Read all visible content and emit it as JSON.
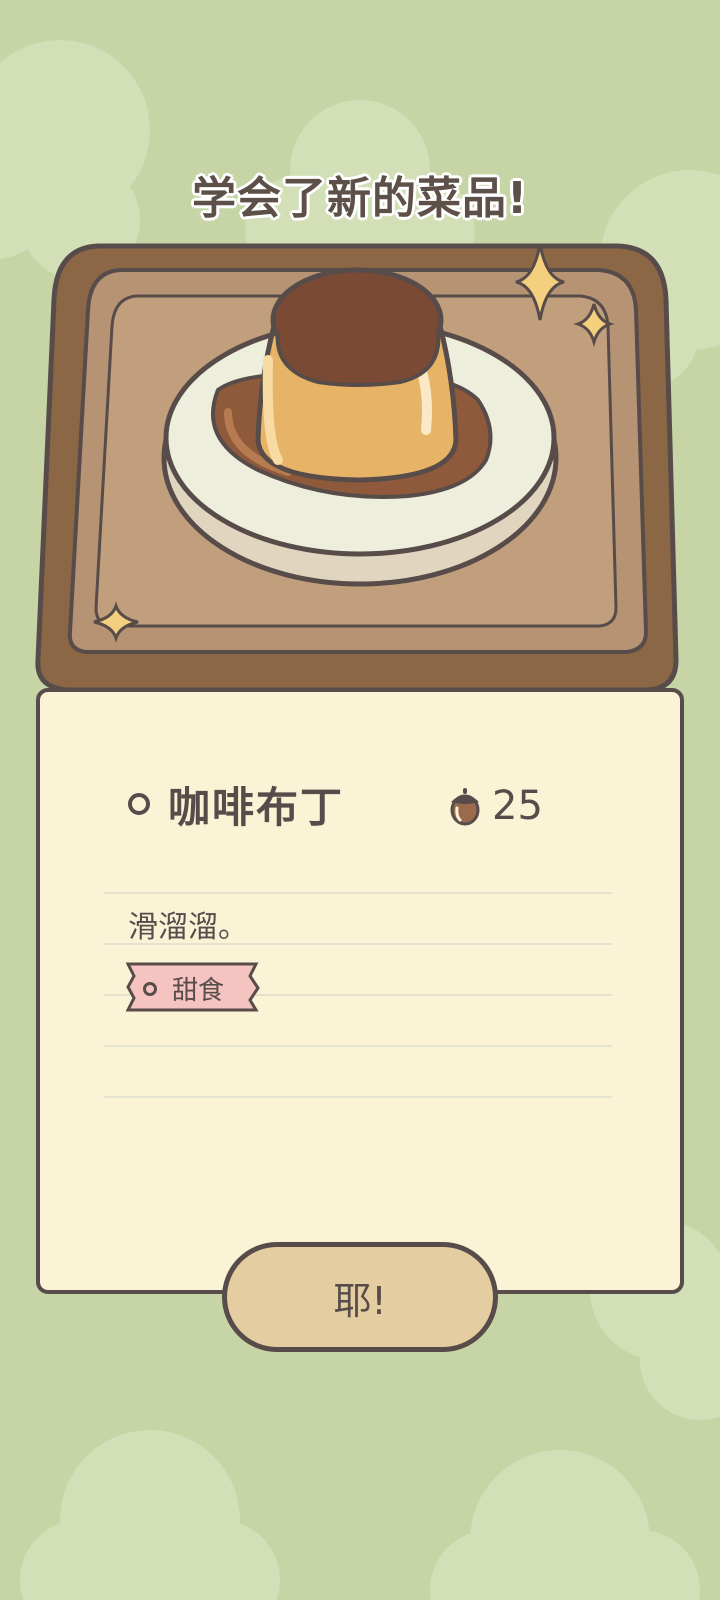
{
  "popup": {
    "title": "学会了新的菜品!",
    "dish": {
      "name": "咖啡布丁",
      "price": "25",
      "price_icon": "acorn-icon",
      "description": "滑溜溜。",
      "tag": "甜食"
    },
    "confirm_label": "耶!"
  },
  "colors": {
    "background": "#c6d4a6",
    "card": "#fbf3d6",
    "outline": "#574c49",
    "tray": "#9c7652",
    "button": "#e3cda1",
    "tag": "#f6c4c0"
  }
}
